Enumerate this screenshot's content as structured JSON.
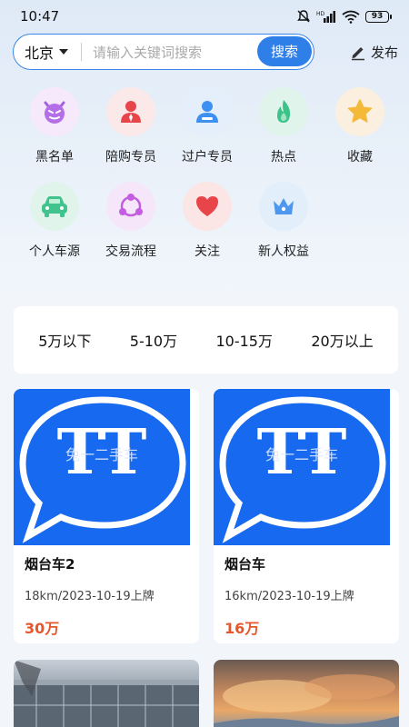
{
  "status_bar": {
    "time": "10:47",
    "battery": "93"
  },
  "search": {
    "city": "北京",
    "placeholder": "请输入关键词搜索",
    "button_label": "搜索",
    "publish_label": "发布"
  },
  "categories": [
    {
      "label": "黑名单",
      "icon": "devil-icon",
      "color": "#b46ee8",
      "bg": "#f6e9fb"
    },
    {
      "label": "陪购专员",
      "icon": "agent-icon",
      "color": "#e8454a",
      "bg": "#fbe8e8"
    },
    {
      "label": "过户专员",
      "icon": "user-badge-icon",
      "color": "#3d8ff0",
      "bg": "#e4effb"
    },
    {
      "label": "热点",
      "icon": "flame-icon",
      "color": "#3cc38a",
      "bg": "#e1f4ec"
    },
    {
      "label": "收藏",
      "icon": "star-icon",
      "color": "#f5b93a",
      "bg": "#fbefdf"
    },
    {
      "label": "个人车源",
      "icon": "car-icon",
      "color": "#40c38c",
      "bg": "#e1f4ec"
    },
    {
      "label": "交易流程",
      "icon": "cycle-icon",
      "color": "#c45ee0",
      "bg": "#f6e6fa"
    },
    {
      "label": "关注",
      "icon": "heart-icon",
      "color": "#e8454a",
      "bg": "#fbe5e5"
    },
    {
      "label": "新人权益",
      "icon": "crown-icon",
      "color": "#4e97ee",
      "bg": "#e3eefb"
    }
  ],
  "price_filters": [
    "5万以下",
    "5-10万",
    "10-15万",
    "20万以上"
  ],
  "listings": [
    {
      "title": "烟台车2",
      "meta": "18km/2023-10-19上牌",
      "price": "30万",
      "watermark": "兔一二手车",
      "logo_text": "TT"
    },
    {
      "title": "烟台车",
      "meta": "16km/2023-10-19上牌",
      "price": "16万",
      "watermark": "兔一二手车",
      "logo_text": "TT"
    }
  ],
  "colors": {
    "accent": "#2f7fe9",
    "price": "#e5572a",
    "card_blue": "#1769ef"
  }
}
